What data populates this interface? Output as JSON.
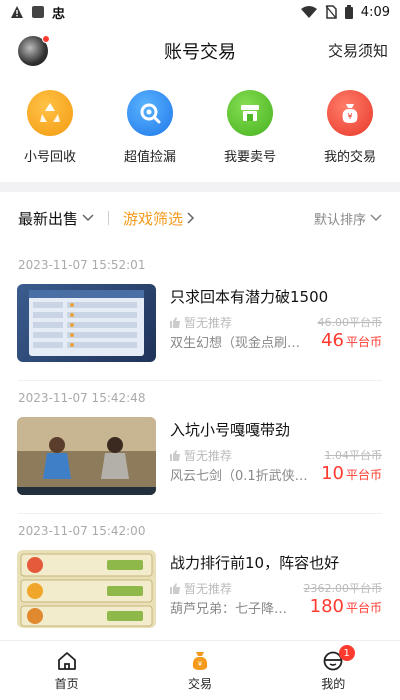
{
  "status_bar": {
    "left_glyph": "忠",
    "time": "4:09"
  },
  "header": {
    "title": "账号交易",
    "right_link": "交易须知"
  },
  "actions": [
    {
      "label": "小号回收",
      "icon": "recycle-icon",
      "color": "#f7a21b"
    },
    {
      "label": "超值捡漏",
      "icon": "magnifier-icon",
      "color": "#2f8ef4"
    },
    {
      "label": "我要卖号",
      "icon": "shop-icon",
      "color": "#5cc531"
    },
    {
      "label": "我的交易",
      "icon": "money-bag-icon",
      "color": "#f24b3c"
    }
  ],
  "filters": {
    "sort": "最新出售",
    "game_filter": "游戏筛选",
    "default_sort": "默认排序"
  },
  "listings": [
    {
      "date": "2023-11-07 15:52:01",
      "title": "只求回本有潜力破1500",
      "recommend": "暂无推荐",
      "desc": "双生幻想（现金点刷…",
      "old_price": "46.00平台币",
      "price": "46",
      "unit": "平台币"
    },
    {
      "date": "2023-11-07 15:42:48",
      "title": "入坑小号嘎嘎带劲",
      "recommend": "暂无推荐",
      "desc": "风云七剑（0.1折武侠…",
      "old_price": "1.04平台币",
      "price": "10",
      "unit": "平台币"
    },
    {
      "date": "2023-11-07 15:42:00",
      "title": "战力排行前10，阵容也好",
      "recommend": "暂无推荐",
      "desc": "葫芦兄弟：七子降…",
      "old_price": "2362.00平台币",
      "price": "180",
      "unit": "平台币"
    }
  ],
  "bottom_nav": [
    {
      "label": "首页",
      "icon": "home-icon"
    },
    {
      "label": "交易",
      "icon": "money-bag-icon"
    },
    {
      "label": "我的",
      "icon": "profile-icon",
      "badge": "1"
    }
  ],
  "colors": {
    "accent_orange": "#f49a1d",
    "price_red": "#ff3b30"
  }
}
